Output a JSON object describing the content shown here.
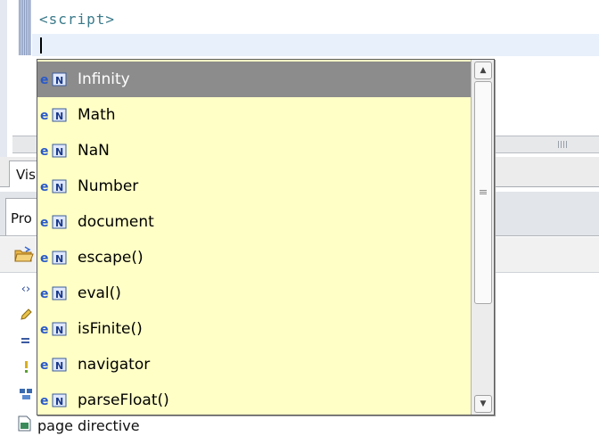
{
  "editor": {
    "code_line": "<script>"
  },
  "tabs": {
    "visual_tab_label": "Vis",
    "properties_tab_label": "Pro"
  },
  "outline": {
    "page_directive_label": "page directive"
  },
  "autocomplete": {
    "selected_index": 0,
    "items": [
      {
        "label": "Infinity",
        "icon": "js-property-icon"
      },
      {
        "label": "Math",
        "icon": "js-property-icon"
      },
      {
        "label": "NaN",
        "icon": "js-property-icon"
      },
      {
        "label": "Number",
        "icon": "js-property-icon"
      },
      {
        "label": "document",
        "icon": "js-property-icon"
      },
      {
        "label": "escape()",
        "icon": "js-function-icon"
      },
      {
        "label": "eval()",
        "icon": "js-function-icon"
      },
      {
        "label": "isFinite()",
        "icon": "js-function-icon"
      },
      {
        "label": "navigator",
        "icon": "js-property-icon"
      },
      {
        "label": "parseFloat()",
        "icon": "js-function-icon"
      }
    ]
  },
  "colors": {
    "popup_background": "#ffffc6",
    "selection": "#8c8c8c",
    "code_text": "#3a7a8a"
  }
}
